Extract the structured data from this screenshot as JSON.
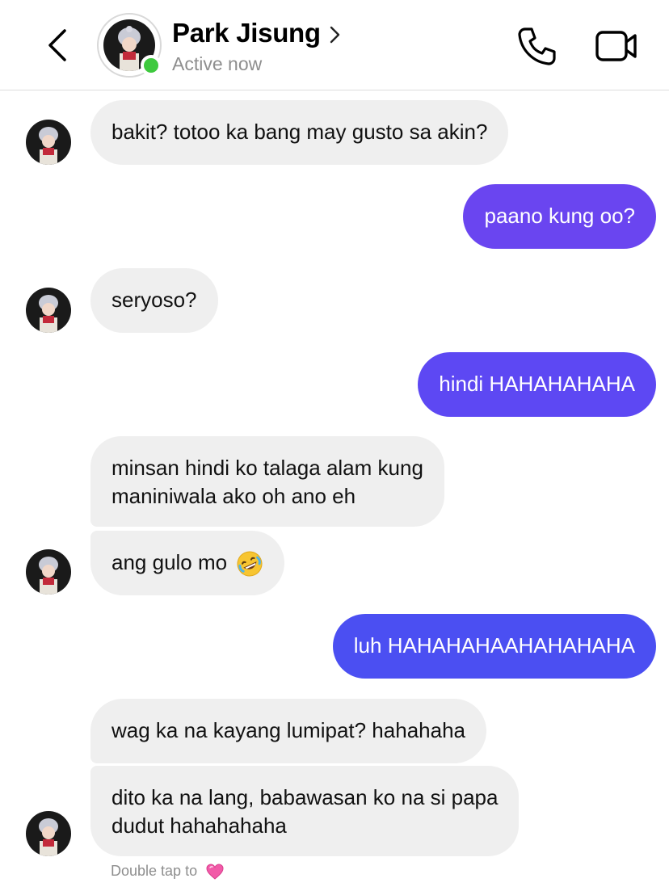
{
  "header": {
    "name": "Park Jisung",
    "status": "Active now"
  },
  "messages": [
    {
      "side": "in",
      "text": "bakit? totoo ka bang may gusto sa akin?"
    },
    {
      "side": "out",
      "text": "paano kung oo?"
    },
    {
      "side": "in",
      "text": "seryoso?"
    },
    {
      "side": "out",
      "text": "hindi HAHAHAHAHA"
    },
    {
      "side": "in",
      "lines": [
        "minsan hindi ko talaga alam kung",
        "maniniwala ako oh ano eh"
      ]
    },
    {
      "side": "in",
      "text": "ang gulo mo",
      "emoji": "rolling-on-floor-laughing-emoji"
    },
    {
      "side": "out",
      "text": "luh HAHAHAHAAHAHAHAHA"
    },
    {
      "side": "in",
      "text": "wag ka na kayang lumipat? hahahaha"
    },
    {
      "side": "in",
      "lines": [
        "dito ka na lang, babawasan ko na si papa",
        "dudut hahahahaha"
      ]
    }
  ],
  "footer": {
    "hint": "Double tap to",
    "hint_emoji": "pink-heart-emoji"
  },
  "colors": {
    "outgoing_bubble": "#5b45f5",
    "incoming_bubble": "#efefef",
    "online": "#3ec93e"
  }
}
